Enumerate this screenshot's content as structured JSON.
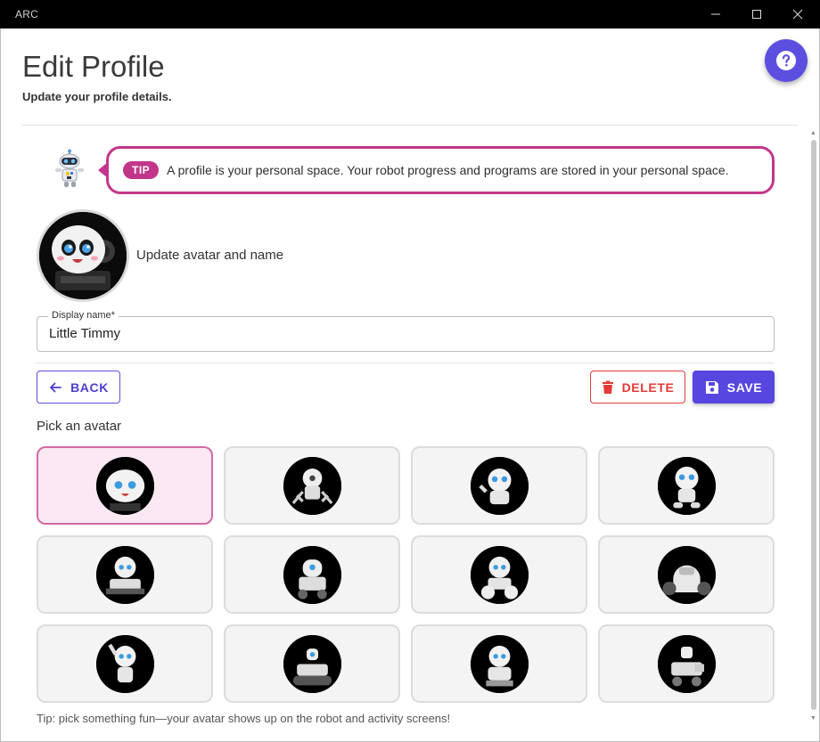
{
  "window": {
    "title": "ARC"
  },
  "header": {
    "title": "Edit Profile",
    "subtitle": "Update your profile details."
  },
  "tip": {
    "badge": "TIP",
    "text": "A profile is your personal space. Your robot progress and programs are stored in your personal space."
  },
  "avatar_section": {
    "heading": "Update avatar and name"
  },
  "display_name": {
    "label": "Display name*",
    "value": "Little Timmy"
  },
  "actions": {
    "back_label": "BACK",
    "delete_label": "DELETE",
    "save_label": "SAVE"
  },
  "picker": {
    "heading": "Pick an avatar",
    "selected_index": 0,
    "avatar_count": 12
  },
  "footer": {
    "tip": "Tip: pick something fun—your avatar shows up on the robot and activity screens!"
  },
  "colors": {
    "accent": "#5746e0",
    "tip_magenta": "#c2368a",
    "delete_red": "#e53935",
    "selected_tile": "#fbe8f3"
  }
}
